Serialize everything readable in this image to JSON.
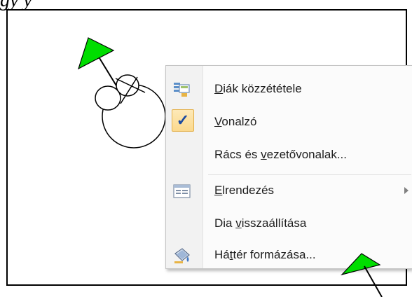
{
  "top_text": "gy    y",
  "menu": {
    "items": [
      {
        "pre": "",
        "u": "D",
        "post": "iák közzététele",
        "icon": "publish-slides-icon"
      },
      {
        "pre": "",
        "u": "V",
        "post": "onalzó",
        "icon": "checkmark-icon",
        "checked": true
      },
      {
        "pre": "Rács és ",
        "u": "v",
        "post": "ezetővonalak...",
        "icon": ""
      },
      {
        "pre": "",
        "u": "E",
        "post": "lrendezés",
        "icon": "layout-icon",
        "submenu": true
      },
      {
        "pre": "Dia ",
        "u": "v",
        "post": "isszaállítása",
        "icon": ""
      },
      {
        "pre": "Há",
        "u": "t",
        "post": "tér formázása...",
        "icon": "format-background-icon"
      }
    ]
  },
  "colors": {
    "pointer_fill": "#00dd00",
    "menu_background": "#fbfbfb",
    "check_highlight": "#fbd98d",
    "check_mark": "#1b4aa0"
  }
}
